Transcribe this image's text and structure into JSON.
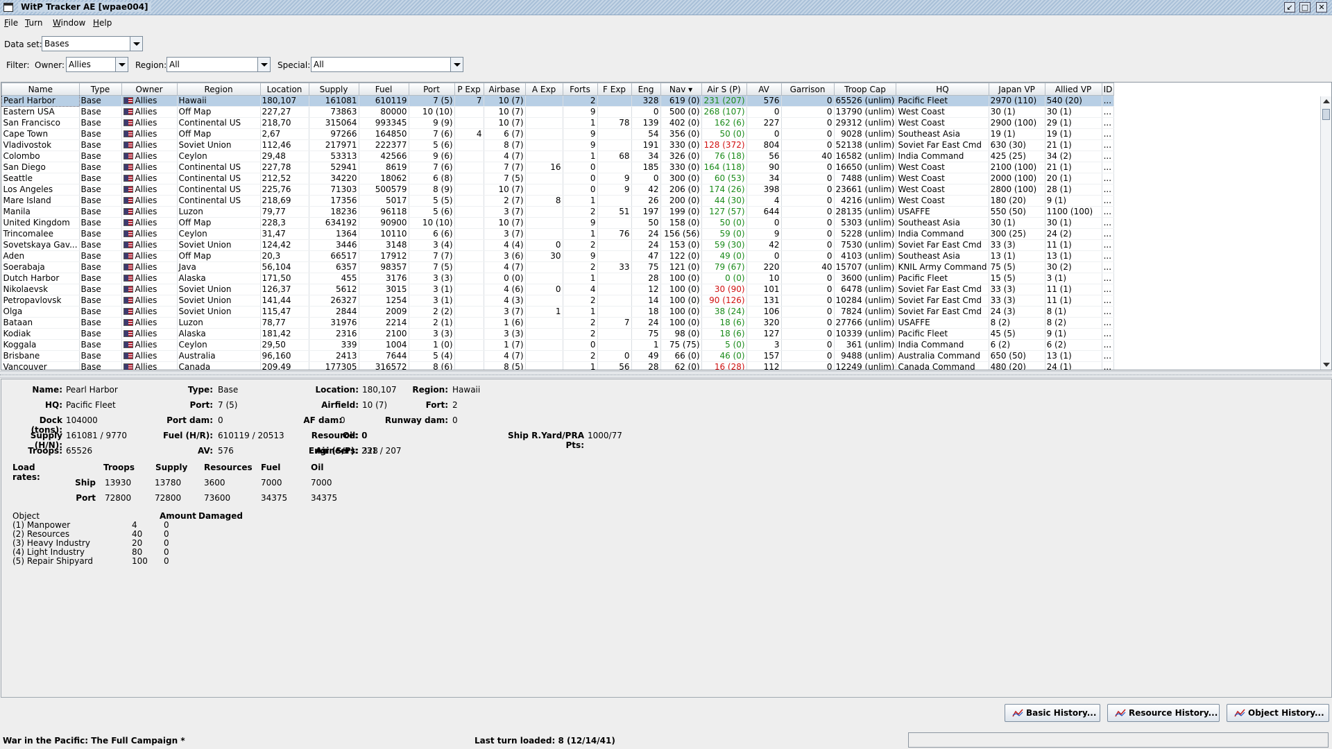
{
  "window": {
    "title": "WitP Tracker AE [wpae004]"
  },
  "menu": [
    {
      "label": "File",
      "key": "F",
      "rest": "ile"
    },
    {
      "label": "Turn",
      "key": "T",
      "rest": "urn"
    },
    {
      "label": "Window",
      "key": "W",
      "rest": "indow"
    },
    {
      "label": "Help",
      "key": "H",
      "rest": "elp"
    }
  ],
  "dataset": {
    "label": "Data set:",
    "value": "Bases"
  },
  "filter": {
    "label": "Filter:",
    "owner_label": "Owner:",
    "owner_value": "Allies",
    "region_label": "Region:",
    "region_value": "All",
    "special_label": "Special:",
    "special_value": "All"
  },
  "table": {
    "columns": [
      "Name",
      "Type",
      "Owner",
      "Region",
      "Location",
      "Supply",
      "Fuel",
      "Port",
      "P Exp",
      "Airbase",
      "A Exp",
      "Forts",
      "F Exp",
      "Eng",
      "Nav ▾",
      "Air S (P)",
      "AV",
      "Garrison",
      "Troop Cap",
      "HQ",
      "Japan VP",
      "Allied VP",
      "ID"
    ],
    "rows": [
      {
        "name": "Pearl Harbor",
        "type": "Base",
        "owner": "Allies",
        "region": "Hawaii",
        "location": "180,107",
        "supply": "161081",
        "fuel": "610119",
        "port": "7 (5)",
        "pexp": "7",
        "airbase": "10 (7)",
        "aexp": "",
        "forts": "2",
        "fexp": "",
        "eng": "328",
        "nav": "619 (0)",
        "airs": "231 (207)",
        "airs_color": "green",
        "av": "576",
        "garrison": "0",
        "troopcap": "65526 (unlim)",
        "hq": "Pacific Fleet",
        "japvp": "2970 (110)",
        "allvp": "540 (20)",
        "id": "..."
      },
      {
        "name": "Eastern USA",
        "type": "Base",
        "owner": "Allies",
        "region": "Off Map",
        "location": "227,27",
        "supply": "73863",
        "fuel": "80000",
        "port": "10 (10)",
        "pexp": "",
        "airbase": "10 (7)",
        "aexp": "",
        "forts": "9",
        "fexp": "",
        "eng": "0",
        "nav": "500 (0)",
        "airs": "268 (107)",
        "airs_color": "green",
        "av": "0",
        "garrison": "0",
        "troopcap": "13790 (unlim)",
        "hq": "West Coast",
        "japvp": "30 (1)",
        "allvp": "30 (1)",
        "id": "..."
      },
      {
        "name": "San Francisco",
        "type": "Base",
        "owner": "Allies",
        "region": "Continental US",
        "location": "218,70",
        "supply": "315064",
        "fuel": "993345",
        "port": "9 (9)",
        "pexp": "",
        "airbase": "10 (7)",
        "aexp": "",
        "forts": "1",
        "fexp": "78",
        "eng": "139",
        "nav": "402 (0)",
        "airs": "162 (6)",
        "airs_color": "green",
        "av": "227",
        "garrison": "0",
        "troopcap": "29312 (unlim)",
        "hq": "West Coast",
        "japvp": "2900 (100)",
        "allvp": "29 (1)",
        "id": "..."
      },
      {
        "name": "Cape Town",
        "type": "Base",
        "owner": "Allies",
        "region": "Off Map",
        "location": "2,67",
        "supply": "97266",
        "fuel": "164850",
        "port": "7 (6)",
        "pexp": "4",
        "airbase": "6 (7)",
        "aexp": "",
        "forts": "9",
        "fexp": "",
        "eng": "54",
        "nav": "356 (0)",
        "airs": "50 (0)",
        "airs_color": "green",
        "av": "0",
        "garrison": "0",
        "troopcap": "9028 (unlim)",
        "hq": "Southeast Asia",
        "japvp": "19 (1)",
        "allvp": "19 (1)",
        "id": "..."
      },
      {
        "name": "Vladivostok",
        "type": "Base",
        "owner": "Allies",
        "region": "Soviet Union",
        "location": "112,46",
        "supply": "217971",
        "fuel": "222377",
        "port": "5 (6)",
        "pexp": "",
        "airbase": "8 (7)",
        "aexp": "",
        "forts": "9",
        "fexp": "",
        "eng": "191",
        "nav": "330 (0)",
        "airs": "128 (372)",
        "airs_color": "red",
        "av": "804",
        "garrison": "0",
        "troopcap": "52138 (unlim)",
        "hq": "Soviet Far East Cmd",
        "japvp": "630 (30)",
        "allvp": "21 (1)",
        "id": "..."
      },
      {
        "name": "Colombo",
        "type": "Base",
        "owner": "Allies",
        "region": "Ceylon",
        "location": "29,48",
        "supply": "53313",
        "fuel": "42566",
        "port": "9 (6)",
        "pexp": "",
        "airbase": "4 (7)",
        "aexp": "",
        "forts": "1",
        "fexp": "68",
        "eng": "34",
        "nav": "326 (0)",
        "airs": "76 (18)",
        "airs_color": "green",
        "av": "56",
        "garrison": "40",
        "troopcap": "16582 (unlim)",
        "hq": "India Command",
        "japvp": "425 (25)",
        "allvp": "34 (2)",
        "id": "..."
      },
      {
        "name": "San Diego",
        "type": "Base",
        "owner": "Allies",
        "region": "Continental US",
        "location": "227,78",
        "supply": "52941",
        "fuel": "8619",
        "port": "7 (6)",
        "pexp": "",
        "airbase": "7 (7)",
        "aexp": "16",
        "forts": "0",
        "fexp": "",
        "eng": "185",
        "nav": "330 (0)",
        "airs": "164 (118)",
        "airs_color": "green",
        "av": "90",
        "garrison": "0",
        "troopcap": "16650 (unlim)",
        "hq": "West Coast",
        "japvp": "2100 (100)",
        "allvp": "21 (1)",
        "id": "..."
      },
      {
        "name": "Seattle",
        "type": "Base",
        "owner": "Allies",
        "region": "Continental US",
        "location": "212,52",
        "supply": "34220",
        "fuel": "18062",
        "port": "6 (8)",
        "pexp": "",
        "airbase": "7 (5)",
        "aexp": "",
        "forts": "0",
        "fexp": "9",
        "eng": "0",
        "nav": "300 (0)",
        "airs": "60 (53)",
        "airs_color": "green",
        "av": "34",
        "garrison": "0",
        "troopcap": "7488 (unlim)",
        "hq": "West Coast",
        "japvp": "2000 (100)",
        "allvp": "20 (1)",
        "id": "..."
      },
      {
        "name": "Los Angeles",
        "type": "Base",
        "owner": "Allies",
        "region": "Continental US",
        "location": "225,76",
        "supply": "71303",
        "fuel": "500579",
        "port": "8 (9)",
        "pexp": "",
        "airbase": "10 (7)",
        "aexp": "",
        "forts": "0",
        "fexp": "9",
        "eng": "42",
        "nav": "206 (0)",
        "airs": "174 (26)",
        "airs_color": "green",
        "av": "398",
        "garrison": "0",
        "troopcap": "23661 (unlim)",
        "hq": "West Coast",
        "japvp": "2800 (100)",
        "allvp": "28 (1)",
        "id": "..."
      },
      {
        "name": "Mare Island",
        "type": "Base",
        "owner": "Allies",
        "region": "Continental US",
        "location": "218,69",
        "supply": "17356",
        "fuel": "5017",
        "port": "5 (5)",
        "pexp": "",
        "airbase": "2 (7)",
        "aexp": "8",
        "forts": "1",
        "fexp": "",
        "eng": "26",
        "nav": "200 (0)",
        "airs": "44 (30)",
        "airs_color": "green",
        "av": "4",
        "garrison": "0",
        "troopcap": "4216 (unlim)",
        "hq": "West Coast",
        "japvp": "180 (20)",
        "allvp": "9 (1)",
        "id": "..."
      },
      {
        "name": "Manila",
        "type": "Base",
        "owner": "Allies",
        "region": "Luzon",
        "location": "79,77",
        "supply": "18236",
        "fuel": "96118",
        "port": "5 (6)",
        "pexp": "",
        "airbase": "3 (7)",
        "aexp": "",
        "forts": "2",
        "fexp": "51",
        "eng": "197",
        "nav": "199 (0)",
        "airs": "127 (57)",
        "airs_color": "green",
        "av": "644",
        "garrison": "0",
        "troopcap": "28135 (unlim)",
        "hq": "USAFFE",
        "japvp": "550 (50)",
        "allvp": "1100 (100)",
        "id": "..."
      },
      {
        "name": "United Kingdom",
        "type": "Base",
        "owner": "Allies",
        "region": "Off Map",
        "location": "228,3",
        "supply": "634192",
        "fuel": "90900",
        "port": "10 (10)",
        "pexp": "",
        "airbase": "10 (7)",
        "aexp": "",
        "forts": "9",
        "fexp": "",
        "eng": "50",
        "nav": "158 (0)",
        "airs": "50 (0)",
        "airs_color": "green",
        "av": "0",
        "garrison": "0",
        "troopcap": "5303 (unlim)",
        "hq": "Southeast Asia",
        "japvp": "30 (1)",
        "allvp": "30 (1)",
        "id": "..."
      },
      {
        "name": "Trincomalee",
        "type": "Base",
        "owner": "Allies",
        "region": "Ceylon",
        "location": "31,47",
        "supply": "1364",
        "fuel": "10110",
        "port": "6 (6)",
        "pexp": "",
        "airbase": "3 (7)",
        "aexp": "",
        "forts": "1",
        "fexp": "76",
        "eng": "24",
        "nav": "156 (56)",
        "airs": "59 (0)",
        "airs_color": "green",
        "av": "9",
        "garrison": "0",
        "troopcap": "5228 (unlim)",
        "hq": "India Command",
        "japvp": "300 (25)",
        "allvp": "24 (2)",
        "id": "..."
      },
      {
        "name": "Sovetskaya Gav...",
        "type": "Base",
        "owner": "Allies",
        "region": "Soviet Union",
        "location": "124,42",
        "supply": "3446",
        "fuel": "3148",
        "port": "3 (4)",
        "pexp": "",
        "airbase": "4 (4)",
        "aexp": "0",
        "forts": "2",
        "fexp": "",
        "eng": "24",
        "nav": "153 (0)",
        "airs": "59 (30)",
        "airs_color": "green",
        "av": "42",
        "garrison": "0",
        "troopcap": "7530 (unlim)",
        "hq": "Soviet Far East Cmd",
        "japvp": "33 (3)",
        "allvp": "11 (1)",
        "id": "..."
      },
      {
        "name": "Aden",
        "type": "Base",
        "owner": "Allies",
        "region": "Off Map",
        "location": "20,3",
        "supply": "66517",
        "fuel": "17912",
        "port": "7 (7)",
        "pexp": "",
        "airbase": "3 (6)",
        "aexp": "30",
        "forts": "9",
        "fexp": "",
        "eng": "47",
        "nav": "122 (0)",
        "airs": "49 (0)",
        "airs_color": "green",
        "av": "0",
        "garrison": "0",
        "troopcap": "4103 (unlim)",
        "hq": "Southeast Asia",
        "japvp": "13 (1)",
        "allvp": "13 (1)",
        "id": "..."
      },
      {
        "name": "Soerabaja",
        "type": "Base",
        "owner": "Allies",
        "region": "Java",
        "location": "56,104",
        "supply": "6357",
        "fuel": "98357",
        "port": "7 (5)",
        "pexp": "",
        "airbase": "4 (7)",
        "aexp": "",
        "forts": "2",
        "fexp": "33",
        "eng": "75",
        "nav": "121 (0)",
        "airs": "79 (67)",
        "airs_color": "green",
        "av": "220",
        "garrison": "40",
        "troopcap": "15707 (unlim)",
        "hq": "KNIL Army Command",
        "japvp": "75 (5)",
        "allvp": "30 (2)",
        "id": "..."
      },
      {
        "name": "Dutch Harbor",
        "type": "Base",
        "owner": "Allies",
        "region": "Alaska",
        "location": "171,50",
        "supply": "455",
        "fuel": "3176",
        "port": "3 (3)",
        "pexp": "",
        "airbase": "0 (0)",
        "aexp": "",
        "forts": "1",
        "fexp": "",
        "eng": "28",
        "nav": "100 (0)",
        "airs": "0 (0)",
        "airs_color": "green",
        "av": "10",
        "garrison": "0",
        "troopcap": "3600 (unlim)",
        "hq": "Pacific Fleet",
        "japvp": "15 (5)",
        "allvp": "3 (1)",
        "id": "..."
      },
      {
        "name": "Nikolaevsk",
        "type": "Base",
        "owner": "Allies",
        "region": "Soviet Union",
        "location": "126,37",
        "supply": "5612",
        "fuel": "3015",
        "port": "3 (1)",
        "pexp": "",
        "airbase": "4 (6)",
        "aexp": "0",
        "forts": "4",
        "fexp": "",
        "eng": "12",
        "nav": "100 (0)",
        "airs": "30 (90)",
        "airs_color": "red",
        "av": "101",
        "garrison": "0",
        "troopcap": "6478 (unlim)",
        "hq": "Soviet Far East Cmd",
        "japvp": "33 (3)",
        "allvp": "11 (1)",
        "id": "..."
      },
      {
        "name": "Petropavlovsk",
        "type": "Base",
        "owner": "Allies",
        "region": "Soviet Union",
        "location": "141,44",
        "supply": "26327",
        "fuel": "1254",
        "port": "3 (1)",
        "pexp": "",
        "airbase": "4 (3)",
        "aexp": "",
        "forts": "2",
        "fexp": "",
        "eng": "14",
        "nav": "100 (0)",
        "airs": "90 (126)",
        "airs_color": "red",
        "av": "131",
        "garrison": "0",
        "troopcap": "10284 (unlim)",
        "hq": "Soviet Far East Cmd",
        "japvp": "33 (3)",
        "allvp": "11 (1)",
        "id": "..."
      },
      {
        "name": "Olga",
        "type": "Base",
        "owner": "Allies",
        "region": "Soviet Union",
        "location": "115,47",
        "supply": "2844",
        "fuel": "2009",
        "port": "2 (2)",
        "pexp": "",
        "airbase": "3 (7)",
        "aexp": "1",
        "forts": "1",
        "fexp": "",
        "eng": "18",
        "nav": "100 (0)",
        "airs": "38 (24)",
        "airs_color": "green",
        "av": "106",
        "garrison": "0",
        "troopcap": "7824 (unlim)",
        "hq": "Soviet Far East Cmd",
        "japvp": "24 (3)",
        "allvp": "8 (1)",
        "id": "..."
      },
      {
        "name": "Bataan",
        "type": "Base",
        "owner": "Allies",
        "region": "Luzon",
        "location": "78,77",
        "supply": "31976",
        "fuel": "2214",
        "port": "2 (1)",
        "pexp": "",
        "airbase": "1 (6)",
        "aexp": "",
        "forts": "2",
        "fexp": "7",
        "eng": "24",
        "nav": "100 (0)",
        "airs": "18 (6)",
        "airs_color": "green",
        "av": "320",
        "garrison": "0",
        "troopcap": "27766 (unlim)",
        "hq": "USAFFE",
        "japvp": "8 (2)",
        "allvp": "8 (2)",
        "id": "..."
      },
      {
        "name": "Kodiak",
        "type": "Base",
        "owner": "Allies",
        "region": "Alaska",
        "location": "181,42",
        "supply": "2316",
        "fuel": "2100",
        "port": "3 (3)",
        "pexp": "",
        "airbase": "3 (3)",
        "aexp": "",
        "forts": "2",
        "fexp": "",
        "eng": "75",
        "nav": "98 (0)",
        "airs": "18 (6)",
        "airs_color": "green",
        "av": "127",
        "garrison": "0",
        "troopcap": "10339 (unlim)",
        "hq": "Pacific Fleet",
        "japvp": "45 (5)",
        "allvp": "9 (1)",
        "id": "..."
      },
      {
        "name": "Koggala",
        "type": "Base",
        "owner": "Allies",
        "region": "Ceylon",
        "location": "29,50",
        "supply": "339",
        "fuel": "1004",
        "port": "1 (0)",
        "pexp": "",
        "airbase": "1 (7)",
        "aexp": "",
        "forts": "0",
        "fexp": "",
        "eng": "1",
        "nav": "75 (75)",
        "airs": "5 (0)",
        "airs_color": "green",
        "av": "3",
        "garrison": "0",
        "troopcap": "361 (unlim)",
        "hq": "India Command",
        "japvp": "6 (2)",
        "allvp": "6 (2)",
        "id": "..."
      },
      {
        "name": "Brisbane",
        "type": "Base",
        "owner": "Allies",
        "region": "Australia",
        "location": "96,160",
        "supply": "2413",
        "fuel": "7644",
        "port": "5 (4)",
        "pexp": "",
        "airbase": "4 (7)",
        "aexp": "",
        "forts": "2",
        "fexp": "0",
        "eng": "49",
        "nav": "66 (0)",
        "airs": "46 (0)",
        "airs_color": "green",
        "av": "157",
        "garrison": "0",
        "troopcap": "9488 (unlim)",
        "hq": "Australia Command",
        "japvp": "650 (50)",
        "allvp": "13 (1)",
        "id": "..."
      },
      {
        "name": "Vancouver",
        "type": "Base",
        "owner": "Allies",
        "region": "Canada",
        "location": "209,49",
        "supply": "177305",
        "fuel": "316572",
        "port": "8 (6)",
        "pexp": "",
        "airbase": "8 (5)",
        "aexp": "",
        "forts": "1",
        "fexp": "56",
        "eng": "28",
        "nav": "62 (0)",
        "airs": "16 (28)",
        "airs_color": "red",
        "av": "112",
        "garrison": "0",
        "troopcap": "12249 (unlim)",
        "hq": "Canada Command",
        "japvp": "480 (20)",
        "allvp": "24 (1)",
        "id": "..."
      }
    ]
  },
  "detail": {
    "name_label": "Name:",
    "name": "Pearl Harbor",
    "type_label": "Type:",
    "type": "Base",
    "location_label": "Location:",
    "location": "180,107",
    "region_label": "Region:",
    "region": "Hawaii",
    "hq_label": "HQ:",
    "hq": "Pacific Fleet",
    "port_label": "Port:",
    "port": "7 (5)",
    "airfield_label": "Airfield:",
    "airfield": "10 (7)",
    "fort_label": "Fort:",
    "fort": "2",
    "dock_label": "Dock (tons):",
    "dock": "104000",
    "portdam_label": "Port dam:",
    "portdam": "0",
    "afdam_label": "AF dam:",
    "afdam": "0",
    "runway_label": "Runway dam:",
    "runway": "0",
    "supply_label": "Supply (H/N):",
    "supply": "161081 / 9770",
    "fuel_label": "Fuel (H/R):",
    "fuel": "610119 / 20513",
    "oil_label": "Oil:",
    "oil": "0",
    "shipyard_label": "Ship R.Yard/PRA Pts:",
    "shipyard": "1000/77",
    "troops_label": "Troops:",
    "troops": "65526",
    "av_label": "AV:",
    "av": "576",
    "resource_label": "Resource:",
    "resource": "0",
    "engineers_label": "Engineers:",
    "engineers": "328",
    "airsp_label": "Air (S/P):",
    "airsp": "231 / 207"
  },
  "load_rates": {
    "label": "Load rates:",
    "headers": [
      "Troops",
      "Supply",
      "Resources",
      "Fuel",
      "Oil"
    ],
    "ship_label": "Ship",
    "ship": [
      "13930",
      "13780",
      "3600",
      "7000",
      "7000"
    ],
    "port_label": "Port",
    "port": [
      "72800",
      "72800",
      "73600",
      "34375",
      "34375"
    ]
  },
  "objects": {
    "headers": [
      "Object",
      "Amount",
      "Damaged"
    ],
    "rows": [
      {
        "name": "(1) Manpower",
        "amount": "4",
        "damaged": "0"
      },
      {
        "name": "(2) Resources",
        "amount": "40",
        "damaged": "0"
      },
      {
        "name": "(3) Heavy Industry",
        "amount": "20",
        "damaged": "0"
      },
      {
        "name": "(4) Light Industry",
        "amount": "80",
        "damaged": "0"
      },
      {
        "name": "(5) Repair Shipyard",
        "amount": "100",
        "damaged": "0"
      }
    ]
  },
  "buttons": {
    "basic": "Basic History...",
    "resource": "Resource History...",
    "object": "Object History..."
  },
  "status": {
    "left": "War in the Pacific: The Full Campaign  *",
    "mid": "Last turn loaded: 8 (12/14/41)"
  },
  "colors": {
    "green": "#1a8a1a",
    "red": "#d01010",
    "selection": "#b8cfe5"
  }
}
